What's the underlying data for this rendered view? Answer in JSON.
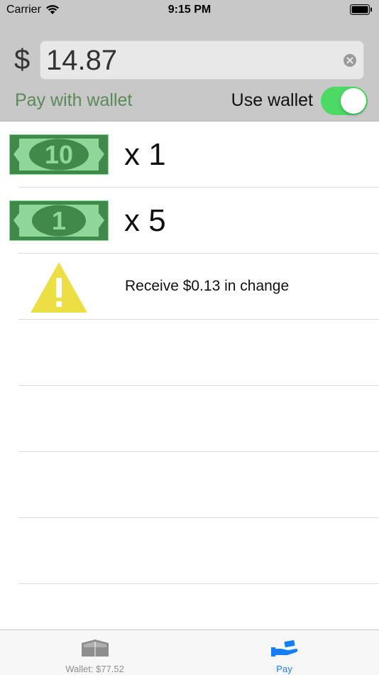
{
  "status_bar": {
    "carrier": "Carrier",
    "time": "9:15 PM"
  },
  "header": {
    "currency_symbol": "$",
    "amount": "14.87",
    "pay_label": "Pay with wallet",
    "use_wallet_label": "Use wallet",
    "use_wallet_on": true
  },
  "rows": [
    {
      "bill": "10",
      "count": "x 1"
    },
    {
      "bill": "1",
      "count": "x 5"
    }
  ],
  "change": {
    "text": "Receive $0.13 in change"
  },
  "tab_bar": {
    "tabs": [
      {
        "label": "Wallet: $77.52",
        "icon": "wallet-icon",
        "selected": false
      },
      {
        "label": "Pay",
        "icon": "pay-hand-icon",
        "selected": true
      }
    ]
  },
  "colors": {
    "header_bg": "#c8c8c8",
    "toggle_on": "#4cd964",
    "bill_green": "#3f8a4a",
    "bill_light": "#8fd69a",
    "warning_yellow": "#ecdf45",
    "tab_active": "#147efb",
    "pay_label": "#5a8a5a"
  }
}
